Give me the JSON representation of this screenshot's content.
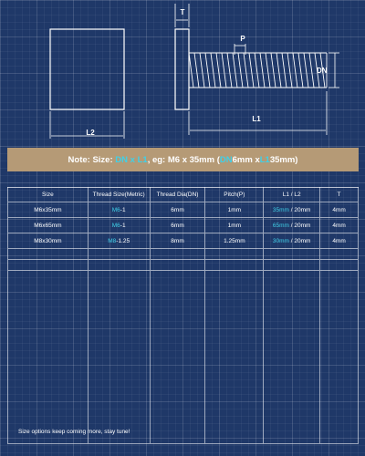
{
  "diagram": {
    "labels": {
      "t": "T",
      "p": "P",
      "dn": "DN",
      "l1": "L1",
      "l2": "L2"
    },
    "colors": {
      "outline": "#ffffff",
      "accent": "#3fd0e8"
    }
  },
  "note": {
    "prefix": "Note: Size: ",
    "dn": "DN",
    "x1": " x ",
    "l1": "L1",
    "eg": ", eg: M6 x 35mm (",
    "dn2": "DN",
    "mid": " 6mm x ",
    "l1b": "L1",
    "suffix": " 35mm)"
  },
  "table": {
    "headers": [
      "Size",
      "Thread Size(Metric)",
      "Thread Dia(DN)",
      "Pitch(P)",
      "L1 / L2",
      "T"
    ],
    "rows": [
      {
        "size": "M6x35mm",
        "thread_hl": "M6",
        "thread_rest": "-1",
        "dia": "6mm",
        "pitch": "1mm",
        "l1": "35mm",
        "l2_rest": " / 20mm",
        "t": "4mm"
      },
      {
        "size": "M6x65mm",
        "thread_hl": "M6",
        "thread_rest": "-1",
        "dia": "6mm",
        "pitch": "1mm",
        "l1": "65mm",
        "l2_rest": " / 20mm",
        "t": "4mm"
      },
      {
        "size": "M8x30mm",
        "thread_hl": "M8",
        "thread_rest": "-1.25",
        "dia": "8mm",
        "pitch": "1.25mm",
        "l1": "30mm",
        "l2_rest": " / 20mm",
        "t": "4mm"
      }
    ]
  },
  "footer": "Size options keep coming more, stay tune!"
}
